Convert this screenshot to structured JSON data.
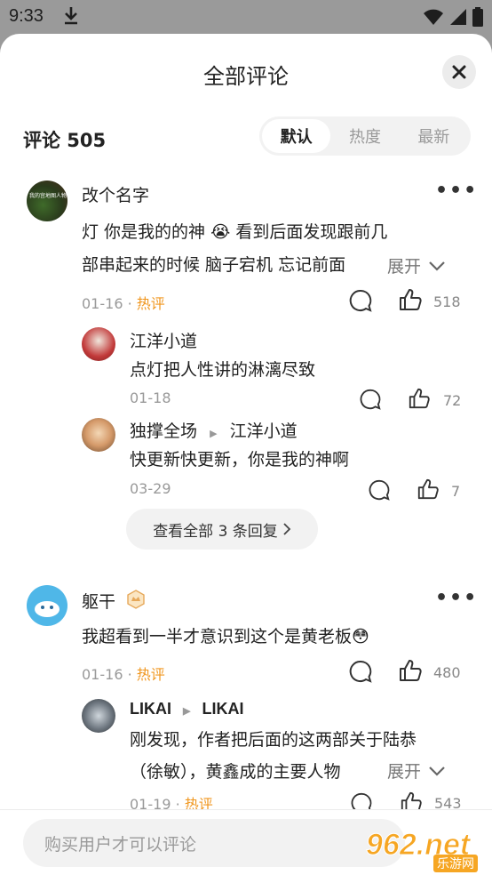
{
  "status": {
    "time": "9:33"
  },
  "sheet": {
    "title": "全部评论",
    "count_label": "评论 505",
    "input_placeholder": "购买用户才可以评论"
  },
  "sort": {
    "tabs": [
      "默认",
      "热度",
      "最新"
    ],
    "active": 0
  },
  "comments": [
    {
      "name": "改个名字",
      "avatar_text": "我的宫地图人物",
      "text_line1": "灯 你是我的的神 😭 看到后面发现跟前几",
      "text_line2": "部串起来的时候 脑子宕机 忘记前面",
      "expand_label": "展开",
      "date": "01-16",
      "sep": "·",
      "tag": "热评",
      "likes": "518",
      "replies": [
        {
          "name": "江洋小道",
          "reply_to": "",
          "text": "点灯把人性讲的淋漓尽致",
          "date": "01-18",
          "likes": "72"
        },
        {
          "name": "独撑全场",
          "reply_to": "江洋小道",
          "text": "快更新快更新，你是我的神啊",
          "date": "03-29",
          "likes": "7"
        }
      ],
      "view_all_label": "查看全部 3 条回复"
    },
    {
      "name": "躯干",
      "text_line1": "我超看到一半才意识到这个是黄老板😳",
      "date": "01-16",
      "sep": "·",
      "tag": "热评",
      "likes": "480",
      "replies": [
        {
          "name": "LIKAI",
          "reply_to": "LIKAI",
          "text_line1": "刚发现，作者把后面的这两部关于陆恭",
          "text_line2": "（徐敏），黄鑫成的主要人物",
          "expand_label": "展开",
          "date": "01-19",
          "sep": "·",
          "tag": "热评",
          "likes": "543"
        }
      ]
    }
  ],
  "watermark": {
    "num": "962.net",
    "sub": "乐游网"
  },
  "colors": {
    "hot": "#f0961e",
    "watermark": "#f6a623"
  }
}
